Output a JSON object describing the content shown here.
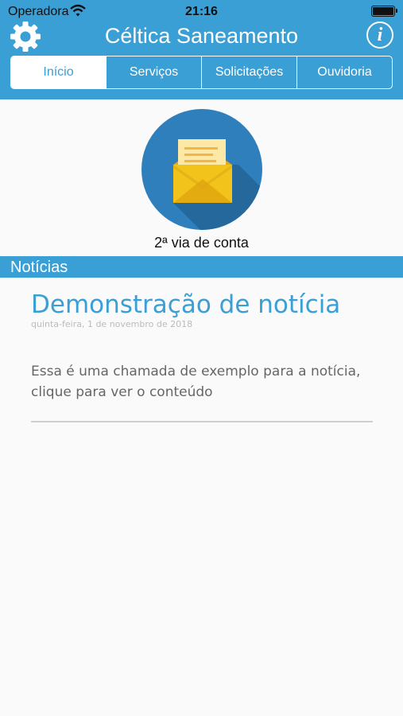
{
  "status_bar": {
    "carrier": "Operadora",
    "time": "21:16"
  },
  "header": {
    "title": "Céltica Saneamento",
    "info_label": "i"
  },
  "tabs": [
    {
      "label": "Início",
      "active": true
    },
    {
      "label": "Serviços",
      "active": false
    },
    {
      "label": "Solicitações",
      "active": false
    },
    {
      "label": "Ouvidoria",
      "active": false
    }
  ],
  "bill_copy": {
    "label": "2ª via de conta"
  },
  "news_section": {
    "title": "Notícias"
  },
  "news": [
    {
      "title": "Demonstração de notícia",
      "date": "quinta-feira, 1 de novembro de 2018",
      "summary": "Essa é uma chamada de exemplo para a notícia, clique para ver o conteúdo"
    }
  ],
  "colors": {
    "accent": "#3a9fd4",
    "envelope": "#f2c31a",
    "letter": "#fde8a6"
  }
}
